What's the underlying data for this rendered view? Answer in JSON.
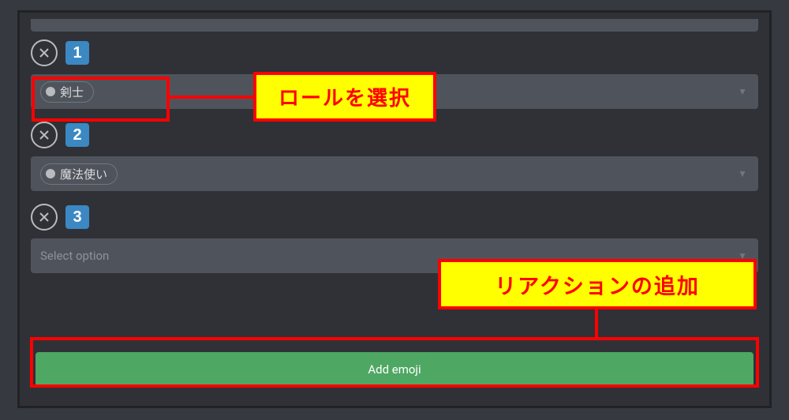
{
  "rows": [
    {
      "badge": "1",
      "role_label": "剣士"
    },
    {
      "badge": "2",
      "role_label": "魔法使い"
    },
    {
      "badge": "3",
      "placeholder": "Select option"
    }
  ],
  "add_emoji_label": "Add emoji",
  "annotations": {
    "select_role": "ロールを選択",
    "add_reaction": "リアクションの追加"
  },
  "colors": {
    "accent_blue": "#3b88c3",
    "button_green": "#4ea763",
    "annotation_border": "#ff0000",
    "annotation_bg": "#ffff00",
    "panel_bg": "#2f3136"
  }
}
